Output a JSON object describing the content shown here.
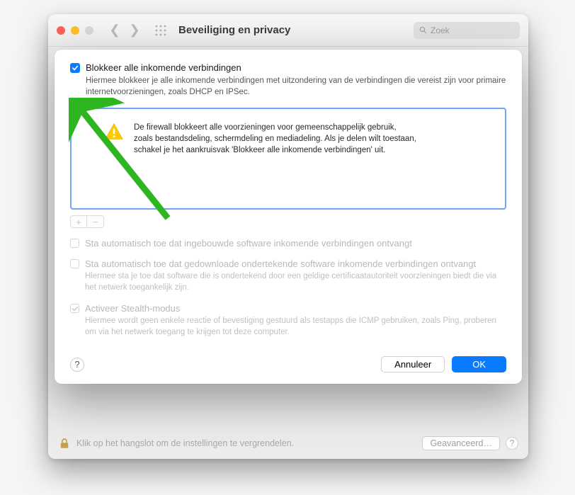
{
  "window": {
    "title": "Beveiliging en privacy",
    "search_placeholder": "Zoek"
  },
  "modal": {
    "block_all": {
      "label": "Blokkeer alle inkomende verbindingen",
      "desc": "Hiermee blokkeer je alle inkomende verbindingen met uitzondering van de verbindingen die vereist zijn voor primaire internetvoorzieningen, zoals DHCP en IPSec."
    },
    "warning_text": "De firewall blokkeert alle voorzieningen voor gemeenschappelijk gebruik, zoals bestandsdeling, schermdeling en mediadeling. Als je delen wilt toestaan, schakel je het aankruisvak 'Blokkeer alle inkomende verbindingen' uit.",
    "auto_builtin": {
      "label": "Sta automatisch toe dat ingebouwde software inkomende verbindingen ontvangt"
    },
    "auto_signed": {
      "label": "Sta automatisch toe dat gedownloade ondertekende software inkomende verbindingen ontvangt",
      "desc": "Hiermee sta je toe dat software die is ondertekend door een geldige certificaatautoriteit voorzieningen biedt die via het netwerk toegankelijk zijn."
    },
    "stealth": {
      "label": "Activeer Stealth-modus",
      "desc": "Hiermee wordt geen enkele reactie of bevestiging gestuurd als testapps die ICMP gebruiken, zoals Ping, proberen om via het netwerk toegang te krijgen tot deze computer."
    },
    "plus": "+",
    "minus": "−",
    "help": "?",
    "cancel": "Annuleer",
    "ok": "OK"
  },
  "footer": {
    "lock_text": "Klik op het hangslot om de instellingen te vergrendelen.",
    "advanced": "Geavanceerd…"
  }
}
